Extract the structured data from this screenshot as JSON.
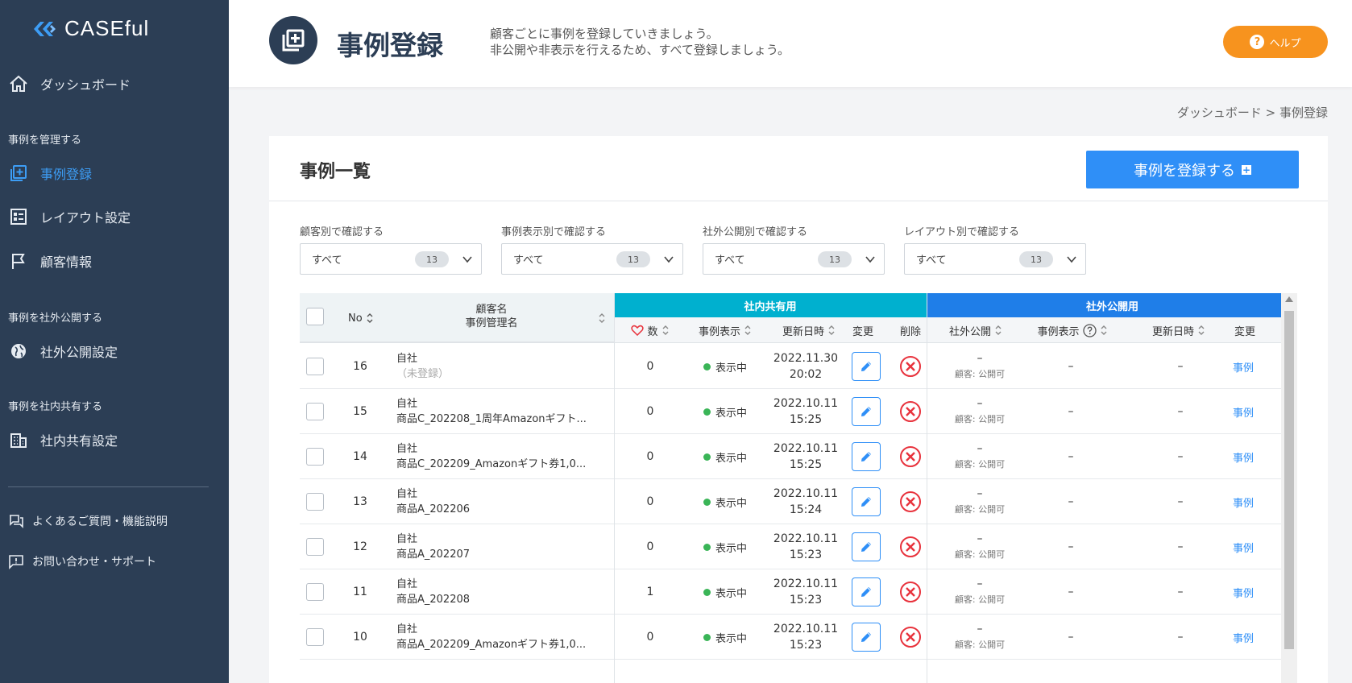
{
  "brand": {
    "name": "CASEful"
  },
  "sidebar": {
    "dashboard": "ダッシュボード",
    "section_manage": "事例を管理する",
    "case_register": "事例登録",
    "layout_settings": "レイアウト設定",
    "customer_info": "顧客情報",
    "section_public": "事例を社外公開する",
    "public_settings": "社外公開設定",
    "section_internal": "事例を社内共有する",
    "internal_settings": "社内共有設定",
    "faq": "よくあるご質問・機能説明",
    "contact": "お問い合わせ・サポート"
  },
  "header": {
    "title": "事例登録",
    "desc_line1": "顧客ごとに事例を登録していきましょう。",
    "desc_line2": "非公開や非表示を行えるため、すべて登録しましょう。",
    "help": "ヘルプ",
    "help_q": "?"
  },
  "breadcrumb": "ダッシュボード > 事例登録",
  "card": {
    "title": "事例一覧",
    "register_button": "事例を登録する",
    "plus": "+"
  },
  "filters": [
    {
      "label": "顧客別で確認する",
      "value": "すべて",
      "count": "13"
    },
    {
      "label": "事例表示別で確認する",
      "value": "すべて",
      "count": "13"
    },
    {
      "label": "社外公開別で確認する",
      "value": "すべて",
      "count": "13"
    },
    {
      "label": "レイアウト別で確認する",
      "value": "すべて",
      "count": "13"
    }
  ],
  "table": {
    "group_internal": "社内共有用",
    "group_public": "社外公開用",
    "group_internal_color": "#00b0cf",
    "group_public_color": "#1f7ee8",
    "col_no": "No",
    "col_name1": "顧客名",
    "col_name2": "事例管理名",
    "col_likes": "数",
    "col_display": "事例表示",
    "col_updated": "更新日時",
    "col_edit": "変更",
    "col_delete": "削除",
    "col_pub": "社外公開",
    "col_pub_display": "事例表示",
    "col_pub_updated": "更新日時",
    "col_pub_edit": "変更",
    "rows": [
      {
        "no": "16",
        "customer": "自社",
        "case": "（未登録）",
        "muted": true,
        "likes": "0",
        "status": "表示中",
        "date": "2022.11.30",
        "time": "20:02",
        "pub": "–",
        "pub_sub": "顧客: 公開可",
        "pub_display": "–",
        "pub_updated": "–",
        "pub_edit": "事例"
      },
      {
        "no": "15",
        "customer": "自社",
        "case": "商品C_202208_1周年Amazonギフト...",
        "muted": false,
        "likes": "0",
        "status": "表示中",
        "date": "2022.10.11",
        "time": "15:25",
        "pub": "–",
        "pub_sub": "顧客: 公開可",
        "pub_display": "–",
        "pub_updated": "–",
        "pub_edit": "事例"
      },
      {
        "no": "14",
        "customer": "自社",
        "case": "商品C_202209_Amazonギフト券1,0...",
        "muted": false,
        "likes": "0",
        "status": "表示中",
        "date": "2022.10.11",
        "time": "15:25",
        "pub": "–",
        "pub_sub": "顧客: 公開可",
        "pub_display": "–",
        "pub_updated": "–",
        "pub_edit": "事例"
      },
      {
        "no": "13",
        "customer": "自社",
        "case": "商品A_202206",
        "muted": false,
        "likes": "0",
        "status": "表示中",
        "date": "2022.10.11",
        "time": "15:24",
        "pub": "–",
        "pub_sub": "顧客: 公開可",
        "pub_display": "–",
        "pub_updated": "–",
        "pub_edit": "事例"
      },
      {
        "no": "12",
        "customer": "自社",
        "case": "商品A_202207",
        "muted": false,
        "likes": "0",
        "status": "表示中",
        "date": "2022.10.11",
        "time": "15:23",
        "pub": "–",
        "pub_sub": "顧客: 公開可",
        "pub_display": "–",
        "pub_updated": "–",
        "pub_edit": "事例"
      },
      {
        "no": "11",
        "customer": "自社",
        "case": "商品A_202208",
        "muted": false,
        "likes": "1",
        "status": "表示中",
        "date": "2022.10.11",
        "time": "15:23",
        "pub": "–",
        "pub_sub": "顧客: 公開可",
        "pub_display": "–",
        "pub_updated": "–",
        "pub_edit": "事例"
      },
      {
        "no": "10",
        "customer": "自社",
        "case": "商品A_202209_Amazonギフト券1,0...",
        "muted": false,
        "likes": "0",
        "status": "表示中",
        "date": "2022.10.11",
        "time": "15:23",
        "pub": "–",
        "pub_sub": "顧客: 公開可",
        "pub_display": "–",
        "pub_updated": "–",
        "pub_edit": "事例"
      }
    ]
  }
}
